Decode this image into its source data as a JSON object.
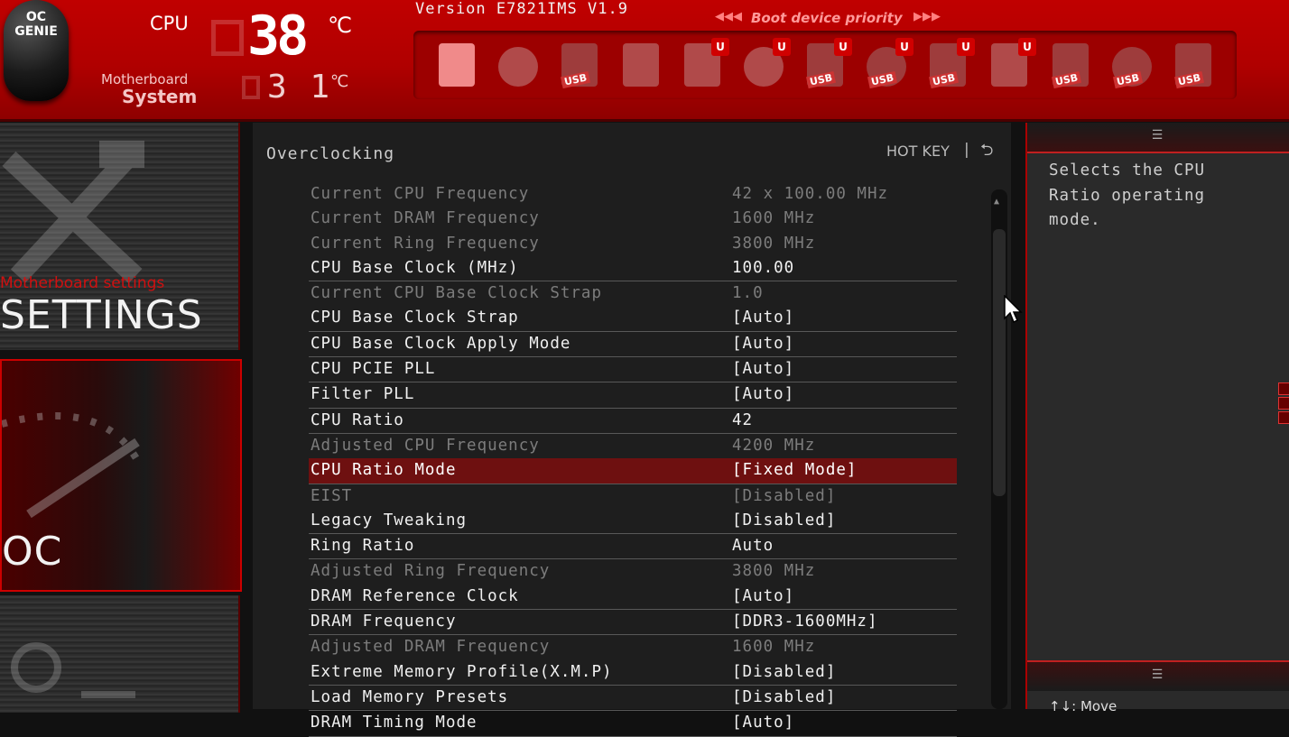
{
  "header": {
    "oc_genie_line1": "OC",
    "oc_genie_line2": "GENIE",
    "cpu_label": "CPU",
    "cpu_temp": "38",
    "temp_unit": "℃",
    "mb_label": "Motherboard",
    "system_label": "System",
    "system_temp": "3 1",
    "version": "Version E7821IMS V1.9",
    "boot_title": "Boot device priority",
    "boot_left_arrows": "◀◀◀",
    "boot_right_arrows": "▶▶▶",
    "boot_devices": [
      {
        "type": "hdd",
        "usb": false,
        "u": false
      },
      {
        "type": "disc",
        "usb": false,
        "u": false
      },
      {
        "type": "usb-key",
        "usb": true,
        "u": false
      },
      {
        "type": "card",
        "usb": false,
        "u": false
      },
      {
        "type": "hdd",
        "usb": false,
        "u": true
      },
      {
        "type": "disc",
        "usb": false,
        "u": true
      },
      {
        "type": "hdd",
        "usb": true,
        "u": true
      },
      {
        "type": "disc",
        "usb": true,
        "u": true
      },
      {
        "type": "usb-key",
        "usb": true,
        "u": true
      },
      {
        "type": "card",
        "usb": false,
        "u": true
      },
      {
        "type": "hdd",
        "usb": true,
        "u": false
      },
      {
        "type": "disc",
        "usb": true,
        "u": false
      },
      {
        "type": "floppy",
        "usb": true,
        "u": false
      }
    ],
    "usb_tag": "USB",
    "u_badge": "U"
  },
  "nav": {
    "settings_sub": "Motherboard settings",
    "settings_title": "SETTINGS",
    "oc_title": "OC"
  },
  "main": {
    "section_title": "Overclocking",
    "hotkey": "HOT KEY",
    "hotkey_sep": "|",
    "back_symbol": "⮌",
    "rows": [
      {
        "name": "Current CPU Frequency",
        "value": "42 x 100.00 MHz",
        "kind": "info"
      },
      {
        "name": "Current DRAM Frequency",
        "value": "1600 MHz",
        "kind": "info"
      },
      {
        "name": "Current Ring Frequency",
        "value": "3800 MHz",
        "kind": "info"
      },
      {
        "name": "CPU Base Clock (MHz)",
        "value": "100.00",
        "kind": "edit"
      },
      {
        "name": "Current CPU Base Clock Strap",
        "value": "1.0",
        "kind": "info"
      },
      {
        "name": "CPU Base Clock Strap",
        "value": "[Auto]",
        "kind": "edit"
      },
      {
        "name": "CPU Base Clock Apply Mode",
        "value": "[Auto]",
        "kind": "edit"
      },
      {
        "name": "CPU PCIE PLL",
        "value": "[Auto]",
        "kind": "edit"
      },
      {
        "name": "Filter PLL",
        "value": "[Auto]",
        "kind": "edit"
      },
      {
        "name": "CPU Ratio",
        "value": "42",
        "kind": "edit"
      },
      {
        "name": "Adjusted CPU Frequency",
        "value": "4200 MHz",
        "kind": "info"
      },
      {
        "name": "CPU Ratio Mode",
        "value": "[Fixed Mode]",
        "kind": "sel"
      },
      {
        "name": "EIST",
        "value": "[Disabled]",
        "kind": "dis"
      },
      {
        "name": "Legacy Tweaking",
        "value": "[Disabled]",
        "kind": "edit"
      },
      {
        "name": "Ring Ratio",
        "value": "Auto",
        "kind": "edit"
      },
      {
        "name": "Adjusted Ring Frequency",
        "value": "3800 MHz",
        "kind": "info"
      },
      {
        "name": "DRAM Reference Clock",
        "value": "[Auto]",
        "kind": "edit"
      },
      {
        "name": "DRAM Frequency",
        "value": "[DDR3-1600MHz]",
        "kind": "edit"
      },
      {
        "name": "Adjusted DRAM Frequency",
        "value": "1600 MHz",
        "kind": "info"
      },
      {
        "name": "Extreme Memory Profile(X.M.P)",
        "value": "[Disabled]",
        "kind": "edit"
      },
      {
        "name": "Load Memory Presets",
        "value": "[Disabled]",
        "kind": "edit"
      },
      {
        "name": "DRAM Timing Mode",
        "value": "[Auto]",
        "kind": "edit"
      }
    ]
  },
  "help": {
    "text": "Selects the CPU\nRatio operating\nmode.",
    "legend": "↑↓: Move"
  },
  "colors": {
    "header_red": "#c00000",
    "selected_row": "#6e1010",
    "accent": "#d01010"
  }
}
